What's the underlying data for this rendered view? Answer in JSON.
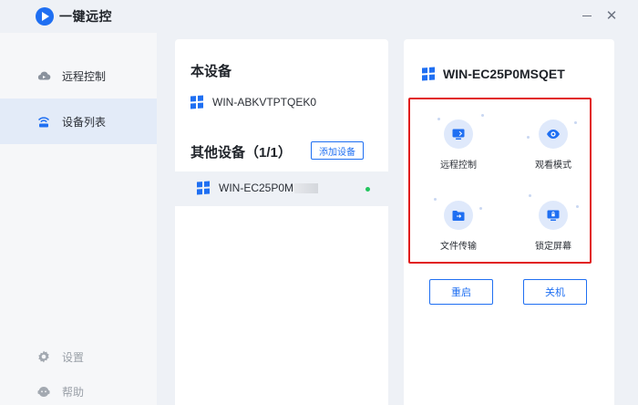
{
  "app": {
    "title": "一键远控"
  },
  "window": {
    "minimize_label": "",
    "close_label": "✕"
  },
  "sidebar": {
    "items": [
      {
        "label": "远程控制",
        "icon": "cloud-remote-icon",
        "active": false
      },
      {
        "label": "设备列表",
        "icon": "device-list-icon",
        "active": true
      }
    ],
    "bottom": [
      {
        "label": "设置",
        "icon": "gear-icon"
      },
      {
        "label": "帮助",
        "icon": "help-icon"
      }
    ]
  },
  "devices": {
    "this_title": "本设备",
    "this_device": "WIN-ABKVTPTQEK0",
    "other_title": "其他设备（1/1）",
    "add_label": "添加设备",
    "other_items": [
      {
        "name": "WIN-EC25P0M",
        "status": "online"
      }
    ]
  },
  "detail": {
    "device_name": "WIN-EC25P0MSQET",
    "ops": [
      {
        "label": "远程控制",
        "icon": "monitor-icon"
      },
      {
        "label": "观看模式",
        "icon": "eye-icon"
      },
      {
        "label": "文件传输",
        "icon": "folder-icon"
      },
      {
        "label": "锁定屏幕",
        "icon": "lock-screen-icon"
      }
    ],
    "restart_label": "重启",
    "shutdown_label": "关机"
  },
  "colors": {
    "accent": "#1f6ff2",
    "highlight_border": "#e11d1d",
    "online": "#22c55e",
    "selected_bg": "#e3ebf8"
  }
}
